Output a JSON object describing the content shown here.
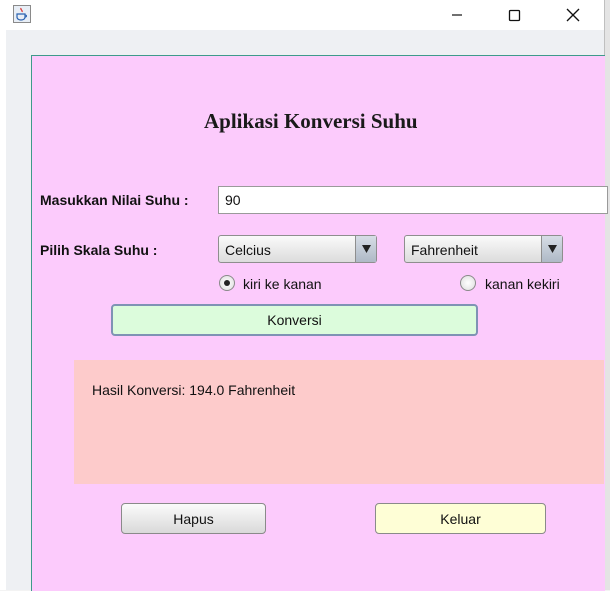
{
  "app": {
    "title": "Aplikasi Konversi Suhu"
  },
  "input": {
    "label": "Masukkan Nilai Suhu :",
    "value": "90"
  },
  "scale": {
    "label": "Pilih Skala Suhu :",
    "from_selected": "Celcius",
    "to_selected": "Fahrenheit"
  },
  "direction": {
    "left_to_right_label": "kiri ke kanan",
    "right_to_left_label": "kanan kekiri",
    "selected": "kiri ke kanan"
  },
  "buttons": {
    "convert_label": "Konversi",
    "clear_label": "Hapus",
    "exit_label": "Keluar"
  },
  "result": {
    "text": "Hasil Konversi: 194.0 Fahrenheit"
  },
  "colors": {
    "panel_bg": "#fccbfc",
    "result_bg": "#fdcbcb",
    "convert_button_bg": "#dcfcdc",
    "exit_button_bg": "#fefed6"
  },
  "icons": {
    "app": "java-cup-icon",
    "minimize": "minimize-icon",
    "maximize": "maximize-icon",
    "close": "close-icon",
    "dropdown": "triangle-down-icon"
  }
}
